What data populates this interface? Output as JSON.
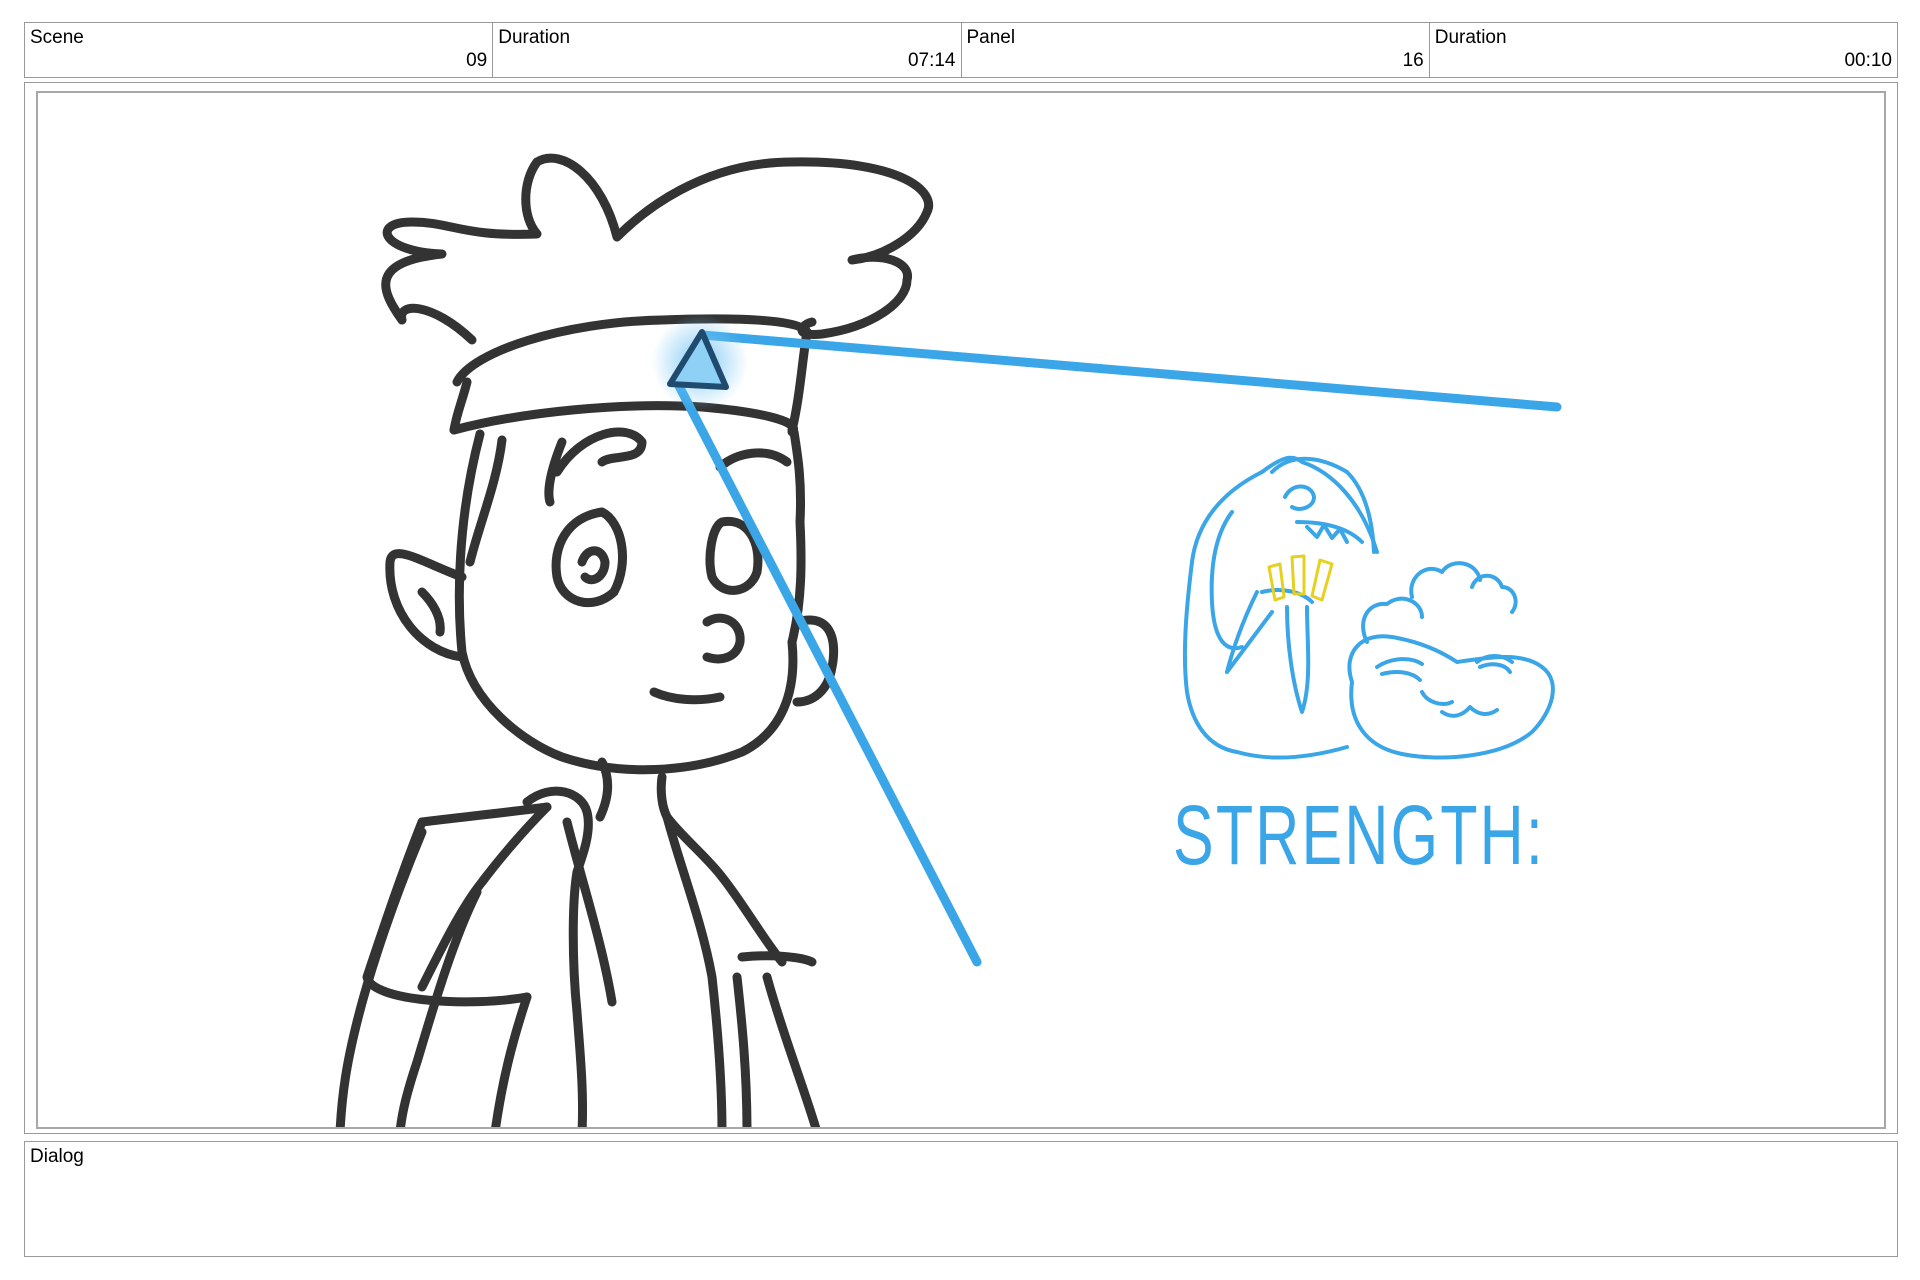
{
  "header": {
    "scene_label": "Scene",
    "scene_value": "09",
    "scene_duration_label": "Duration",
    "scene_duration_value": "07:14",
    "panel_label": "Panel",
    "panel_value": "16",
    "panel_duration_label": "Duration",
    "panel_duration_value": "00:10"
  },
  "panel_art": {
    "caption": "STRENGTH:",
    "sketch_color": "#3aa6e8",
    "ink_color": "#333333",
    "accent_color": "#e6d020"
  },
  "dialog": {
    "label": "Dialog",
    "text": ""
  }
}
